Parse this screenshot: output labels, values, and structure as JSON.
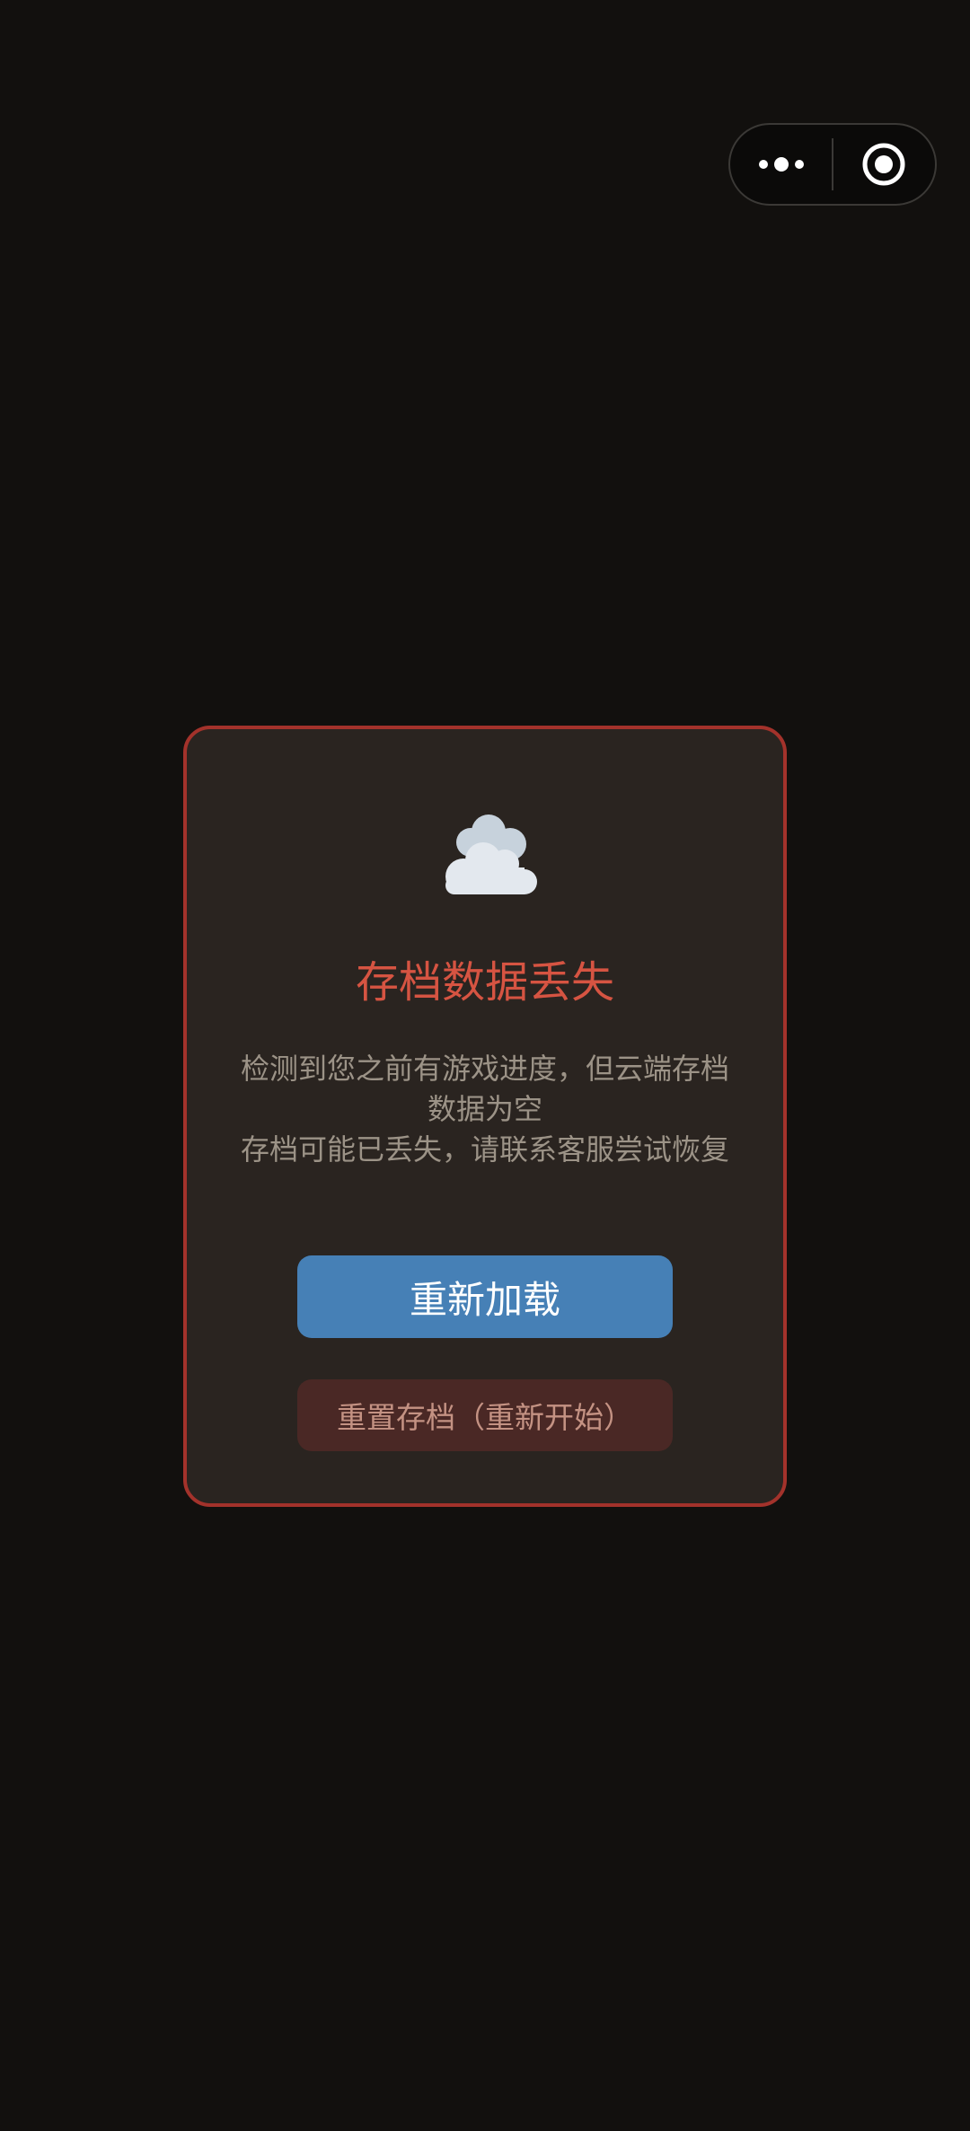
{
  "capsule": {
    "menu_icon": "more-dots-icon",
    "close_icon": "target-close-icon"
  },
  "dialog": {
    "icon": "cloud-icon",
    "title": "存档数据丢失",
    "message": "检测到您之前有游戏进度，但云端存档数据为空\n存档可能已丢失，请联系客服尝试恢复",
    "reload_label": "重新加载",
    "reset_label": "重置存档（重新开始）"
  },
  "colors": {
    "background": "#12100e",
    "dialog_bg": "#2a2420",
    "dialog_border": "#a3322b",
    "title": "#d65442",
    "primary_button": "#4680b6",
    "danger_button": "#4a2825"
  }
}
